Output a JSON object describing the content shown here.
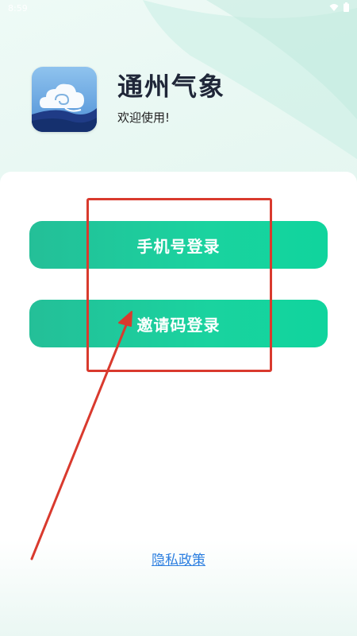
{
  "status_bar": {
    "time": "8:59",
    "wifi_icon": "wifi-icon",
    "battery_icon": "battery-icon"
  },
  "app": {
    "title": "通州气象",
    "subtitle": "欢迎使用!",
    "icon": "cloud-logo-icon"
  },
  "login": {
    "phone_label": "手机号登录",
    "invite_label": "邀请码登录"
  },
  "footer": {
    "privacy_label": "隐私政策"
  },
  "colors": {
    "button_gradient_start": "#24bf98",
    "button_gradient_end": "#10d49d",
    "annotation_red": "#d93a2e",
    "link_blue": "#2d7fe0"
  }
}
